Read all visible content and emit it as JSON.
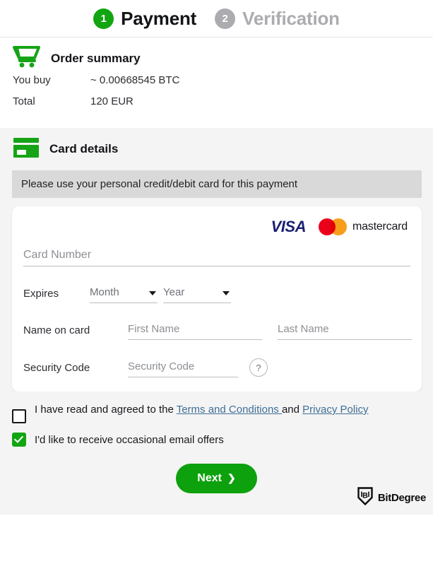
{
  "stepper": {
    "steps": [
      {
        "number": "1",
        "label": "Payment",
        "state": "active"
      },
      {
        "number": "2",
        "label": "Verification",
        "state": "inactive"
      }
    ]
  },
  "order_summary": {
    "icon": "shopping-cart-icon",
    "title": "Order summary",
    "rows": [
      {
        "key": "You buy",
        "value": "~ 0.00668545 BTC"
      },
      {
        "key": "Total",
        "value": "120 EUR"
      }
    ]
  },
  "card_details": {
    "icon": "credit-card-icon",
    "title": "Card details",
    "notice": "Please use your personal credit/debit card for this payment",
    "brands": [
      {
        "name": "visa-logo",
        "text": "VISA"
      },
      {
        "name": "mastercard-logo",
        "text": "mastercard"
      }
    ],
    "card_number": {
      "label": "Card Number",
      "placeholder": "Card Number",
      "value": ""
    },
    "expires": {
      "label": "Expires",
      "month": {
        "placeholder": "Month",
        "value": "Month"
      },
      "year": {
        "placeholder": "Year",
        "value": "Year"
      }
    },
    "name_on_card": {
      "label": "Name on card",
      "first": {
        "placeholder": "First Name",
        "value": ""
      },
      "last": {
        "placeholder": "Last Name",
        "value": ""
      }
    },
    "security_code": {
      "label": "Security Code",
      "placeholder": "Security Code",
      "value": "",
      "help": "?"
    }
  },
  "consents": [
    {
      "checked": false,
      "text_before": "I have read and agreed to the ",
      "link1": "Terms and Conditions ",
      "text_middle": "and ",
      "link2": "Privacy Policy"
    },
    {
      "checked": true,
      "text": "I'd like to receive occasional email offers"
    }
  ],
  "footer": {
    "next_label": "Next",
    "next_chevron": "❯",
    "brand": "BitDegree"
  },
  "colors": {
    "green": "#12A512",
    "gray_step": "#ACACB0",
    "notice_bg": "#D9D9D9",
    "panel_bg": "#F4F4F4",
    "link": "#3E6F97",
    "visa_blue": "#1A1F71",
    "mc_red": "#EB001B",
    "mc_yellow": "#F79E1B"
  }
}
